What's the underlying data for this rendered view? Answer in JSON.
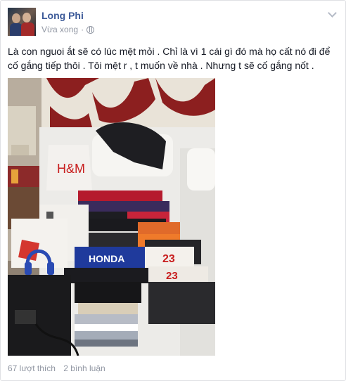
{
  "post": {
    "author": "Long Phi",
    "time": "Vừa xong",
    "separator": "·",
    "text": "Là con nguoi ắt sẽ có lúc mệt mỏi . Chỉ là vì 1 cái gì đó mà họ cất nó đi để cố gắng tiếp thôi . Tôi mệt r , t muốn về nhà . Nhưng t sẽ cố gắng nốt .",
    "photo": {
      "description_icon": "photo-of-clothes-on-bed",
      "shirt_text_1": "HONDA",
      "shirt_text_2": "23",
      "shirt_text_3": "23",
      "bag_text": "H&M"
    },
    "likes": "67 lượt thích",
    "comments": "2 bình luận"
  },
  "icons": {
    "privacy": "globe-icon",
    "menu": "chevron-down-icon"
  }
}
